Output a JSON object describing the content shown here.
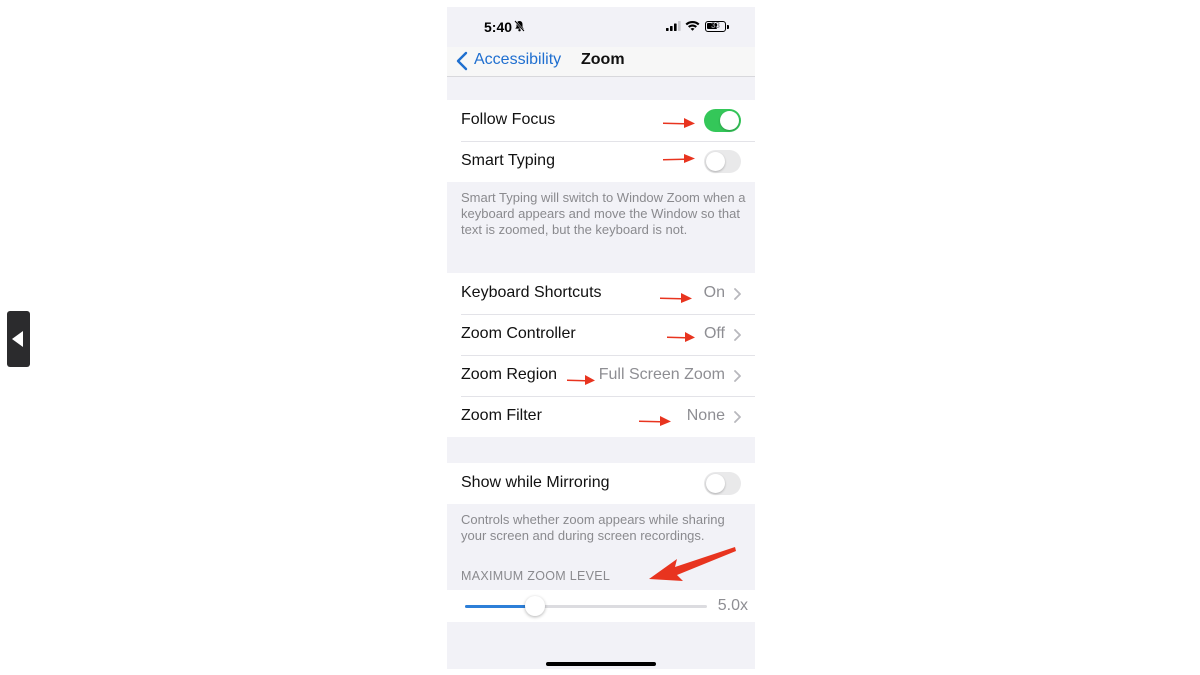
{
  "status_bar": {
    "time": "5:40",
    "battery": "33"
  },
  "nav": {
    "back_label": "Accessibility",
    "title": "Zoom"
  },
  "focus_group": {
    "rows": [
      {
        "label": "Follow Focus",
        "toggle": "on"
      },
      {
        "label": "Smart Typing",
        "toggle": "off"
      }
    ],
    "footnote": "Smart Typing will switch to Window Zoom when a keyboard appears and move the Window so that text is zoomed, but the keyboard is not."
  },
  "options_group": {
    "rows": [
      {
        "label": "Keyboard Shortcuts",
        "value": "On"
      },
      {
        "label": "Zoom Controller",
        "value": "Off"
      },
      {
        "label": "Zoom Region",
        "value": "Full Screen Zoom"
      },
      {
        "label": "Zoom Filter",
        "value": "None"
      }
    ]
  },
  "mirroring_group": {
    "rows": [
      {
        "label": "Show while Mirroring",
        "toggle": "off"
      }
    ],
    "footnote": "Controls whether zoom appears while sharing your screen and during screen recordings."
  },
  "zoom_level": {
    "header": "MAXIMUM ZOOM LEVEL",
    "value_label": "5.0x",
    "slider_fraction": 0.29
  },
  "colors": {
    "accent": "#1f6fd0",
    "toggle_on": "#34c759",
    "annotation_arrow": "#e8341f"
  },
  "icons": {
    "back": "chevron-left-icon",
    "row_disclosure": "chevron-right-icon",
    "status": [
      "bell-slash-icon",
      "cellular-signal-icon",
      "wifi-icon",
      "battery-icon"
    ],
    "side_tab": "triangle-left-icon"
  }
}
